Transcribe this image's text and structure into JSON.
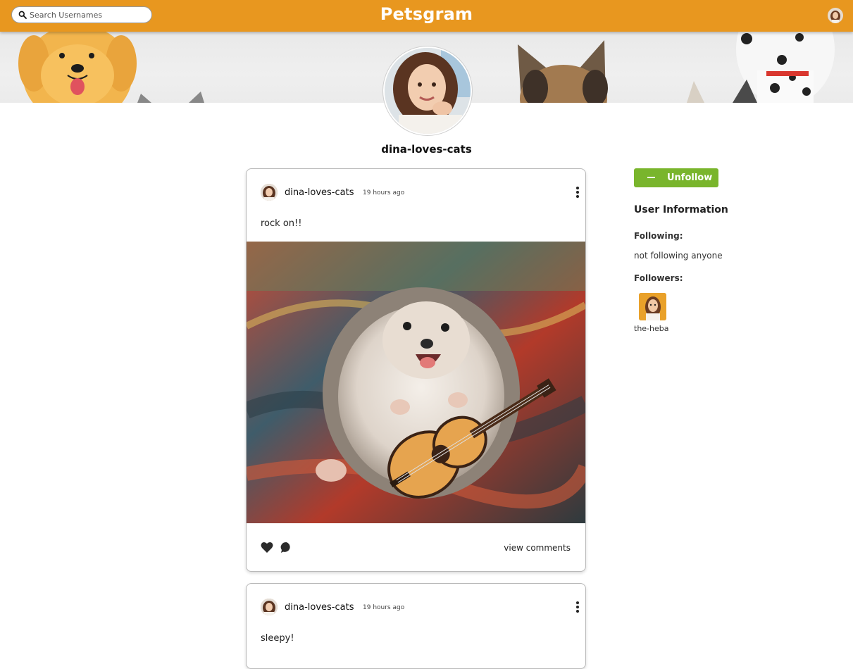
{
  "header": {
    "brand": "Petsgram",
    "search_placeholder": "Search Usernames",
    "search_value": ""
  },
  "profile": {
    "username": "dina-loves-cats"
  },
  "posts": [
    {
      "username": "dina-loves-cats",
      "time": "19 hours ago",
      "caption": "rock on!!",
      "image_subject": "hedgehog playing a tiny guitar on a colorful blanket",
      "view_comments_label": "view comments"
    },
    {
      "username": "dina-loves-cats",
      "time": "19 hours ago",
      "caption": "sleepy!"
    }
  ],
  "sidebar": {
    "unfollow_label": "Unfollow",
    "info_title": "User Information",
    "following_label": "Following:",
    "following_value": "not following anyone",
    "followers_label": "Followers:",
    "followers": [
      {
        "username": "the-heba"
      }
    ]
  },
  "colors": {
    "topbar": "#e8971f",
    "unfollow_button": "#79b52c",
    "background": "#ffffff"
  },
  "icons": {
    "search": "search-icon",
    "more": "more-vertical-icon",
    "like": "heart-icon",
    "comment": "comment-bubble-icon",
    "unfollow": "minus-icon"
  }
}
